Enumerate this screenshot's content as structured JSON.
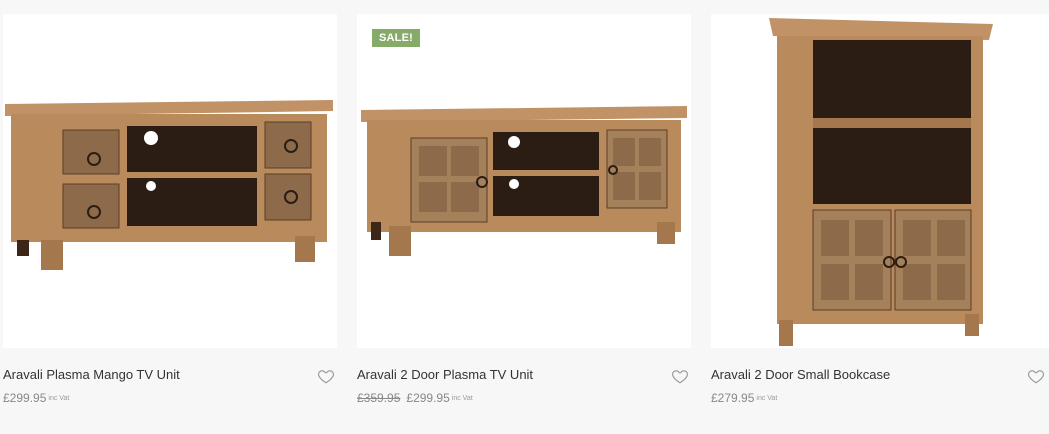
{
  "products": [
    {
      "title": "Aravali Plasma Mango TV Unit",
      "old_price": "",
      "price": "£299.95",
      "vat": "inc Vat",
      "badge": "",
      "icon": "heart-outline-icon"
    },
    {
      "title": "Aravali 2 Door Plasma TV Unit",
      "old_price": "£359.95",
      "price": "£299.95",
      "vat": "inc Vat",
      "badge": "SALE!",
      "icon": "heart-outline-icon"
    },
    {
      "title": "Aravali 2 Door Small Bookcase",
      "old_price": "",
      "price": "£279.95",
      "vat": "inc Vat",
      "badge": "",
      "icon": "heart-outline-icon"
    }
  ],
  "colors": {
    "badge": "#86ab68",
    "wood": "#b98a5c",
    "dark_wood": "#6e4a2e",
    "interior": "#2b1d14"
  }
}
